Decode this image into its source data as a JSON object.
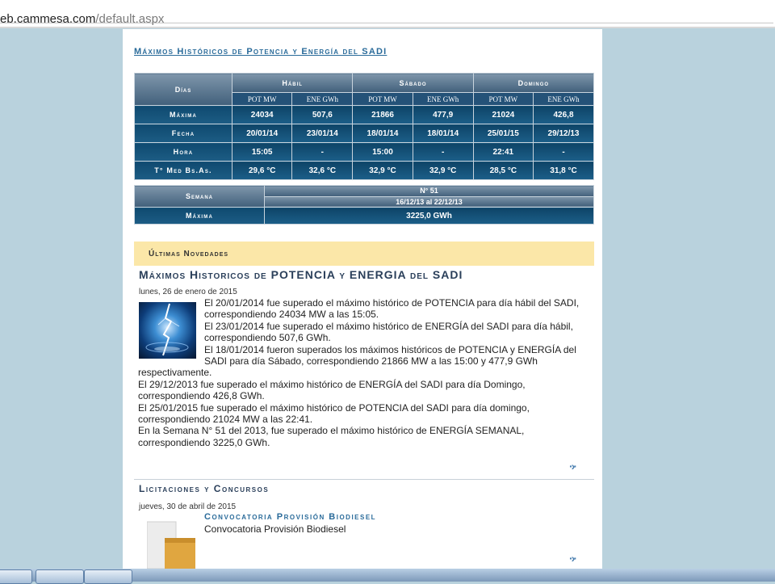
{
  "browser": {
    "url_host": "eb.cammesa.com",
    "url_path": "/default.aspx"
  },
  "title": "Máximos Históricos de Potencia y Energía del SADI",
  "records_table": {
    "row_header": "Días",
    "groups": [
      "Hábil",
      "Sábado",
      "Domingo"
    ],
    "sub_headers": [
      "POT MW",
      "ENE GWh",
      "POT MW",
      "ENE GWh",
      "POT MW",
      "ENE GWh"
    ],
    "rows": [
      {
        "label": "Máxima",
        "values": [
          "24034",
          "507,6",
          "21866",
          "477,9",
          "21024",
          "426,8"
        ]
      },
      {
        "label": "Fecha",
        "values": [
          "20/01/14",
          "23/01/14",
          "18/01/14",
          "18/01/14",
          "25/01/15",
          "29/12/13"
        ]
      },
      {
        "label": "Hora",
        "values": [
          "15:05",
          "-",
          "15:00",
          "-",
          "22:41",
          "-"
        ]
      },
      {
        "label": "T° Med Bs.As.",
        "values": [
          "29,6 °C",
          "32,6 °C",
          "32,9 °C",
          "32,9 °C",
          "28,5 °C",
          "31,8 °C"
        ]
      }
    ]
  },
  "week_table": {
    "label": "Semana",
    "week_number": "N° 51",
    "week_range": "16/12/13 al 22/12/13",
    "max_label": "Máxima",
    "max_value": "3225,0 GWh"
  },
  "news": {
    "section_title": "Últimas Novedades",
    "article_title": "Máximos Historicos de POTENCIA y ENERGIA del SADI",
    "article_date": "lunes, 26 de enero de 2015",
    "paragraphs": [
      "El 20/01/2014 fue superado el máximo histórico de POTENCIA para día hábil del SADI, correspondiendo 24034 MW a las 15:05.",
      "El 23/01/2014 fue superado el máximo histórico de ENERGÍA del SADI para día hábil, correspondiendo 507,6 GWh.",
      "El 18/01/2014 fueron superados los máximos históricos de POTENCIA y ENERGÍA del SADI para día Sábado, correspondiendo 21866 MW a las 15:00 y 477,9 GWh respectivamente.",
      "El 29/12/2013 fue superado el máximo histórico de ENERGÍA del SADI para día Domingo, correspondiendo 426,8 GWh.",
      "El 25/01/2015 fue superado el máximo histórico de POTENCIA del SADI para día domingo, correspondiendo 21024 MW a las 22:41.",
      "En la Semana N° 51 del 2013, fue superado el máximo histórico de ENERGÍA SEMANAL, correspondiendo 3225,0 GWh."
    ],
    "more_icon": "more-arrows-icon"
  },
  "tenders": {
    "section_title": "Licitaciones y Concursos",
    "date": "jueves, 30 de abril de 2015",
    "item_title": "Convocatoria Provisión Biodiesel",
    "item_subtitle": "Convocatoria Provisión Biodiesel",
    "more_icon": "more-arrows-icon"
  },
  "colors": {
    "page_background": "#b9d2dd",
    "table_dark": "#1a5680",
    "news_bar": "#fbe7a8",
    "link_blue": "#2a6b9a"
  }
}
